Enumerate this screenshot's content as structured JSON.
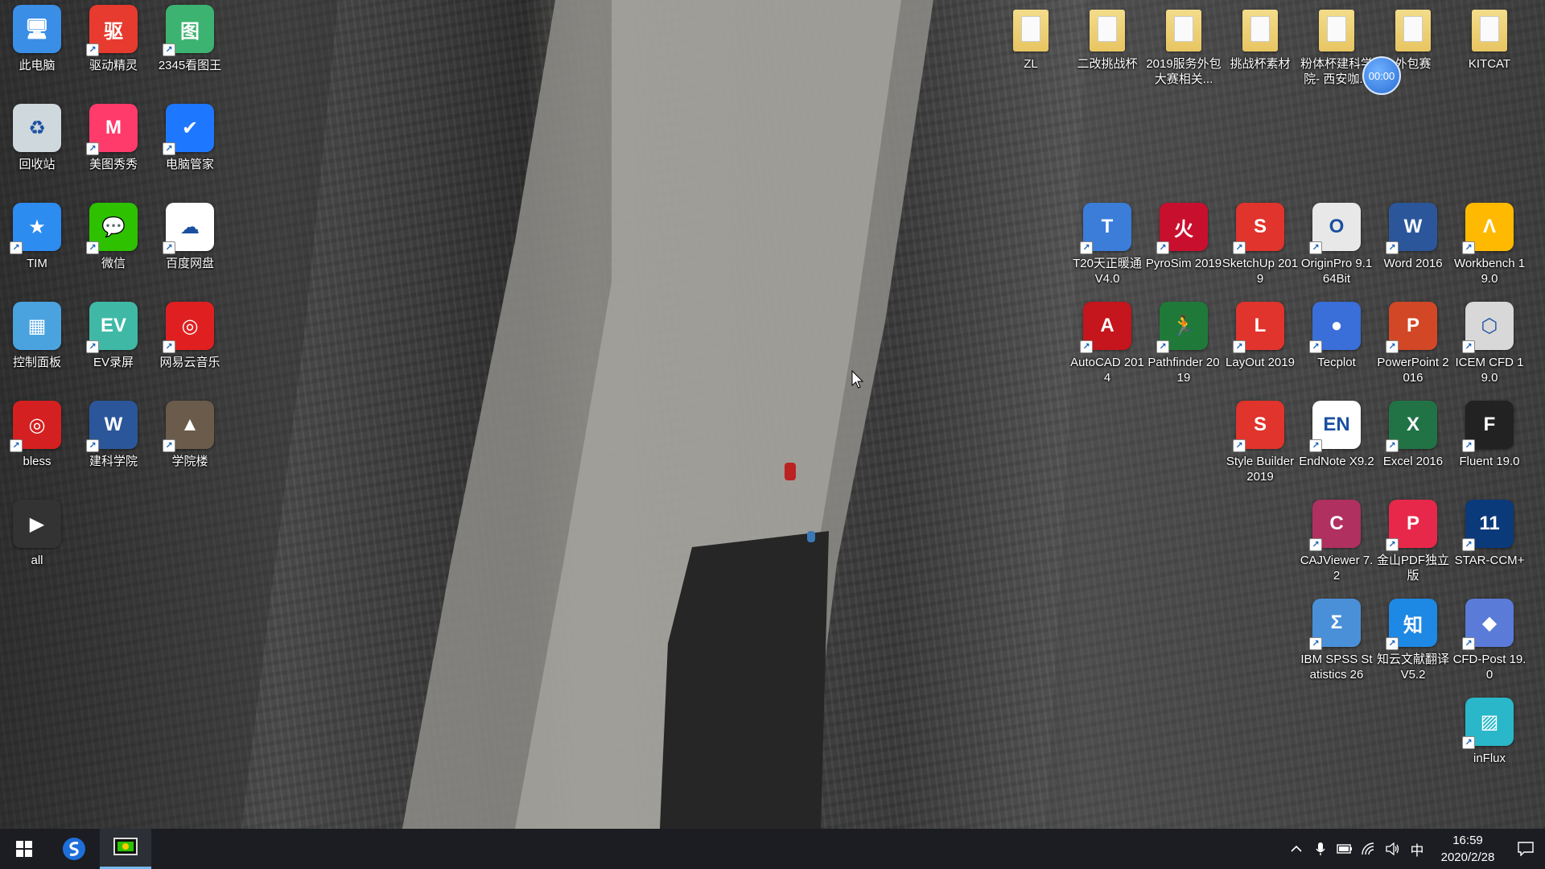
{
  "desktop": {
    "icons": [
      {
        "id": "this-pc",
        "label": "此电脑",
        "glyph": "🖥",
        "color": "#3a8ee6",
        "icon": "computer-icon"
      },
      {
        "id": "driver-genius",
        "label": "驱动精灵",
        "glyph": "驱",
        "color": "#e63b2e",
        "icon": "driver-genius-icon"
      },
      {
        "id": "2345-viewer",
        "label": "2345看图王",
        "glyph": "图",
        "color": "#3cb371",
        "icon": "image-viewer-icon"
      },
      {
        "id": "recycle-bin",
        "label": "回收站",
        "glyph": "♻",
        "color": "#cfd8dc",
        "icon": "recycle-bin-icon"
      },
      {
        "id": "meitu",
        "label": "美图秀秀",
        "glyph": "M",
        "color": "#ff3b6b",
        "icon": "meitu-icon"
      },
      {
        "id": "pc-manager",
        "label": "电脑管家",
        "glyph": "✔",
        "color": "#1e78ff",
        "icon": "pc-manager-icon"
      },
      {
        "id": "tim",
        "label": "TIM",
        "glyph": "★",
        "color": "#2d8cf0",
        "icon": "tim-icon"
      },
      {
        "id": "wechat",
        "label": "微信",
        "glyph": "💬",
        "color": "#2dc100",
        "icon": "wechat-icon"
      },
      {
        "id": "baidu-pan",
        "label": "百度网盘",
        "glyph": "☁",
        "color": "#ffffff",
        "icon": "baidu-pan-icon"
      },
      {
        "id": "control-panel",
        "label": "控制面板",
        "glyph": "▦",
        "color": "#4aa3df",
        "icon": "control-panel-icon"
      },
      {
        "id": "ev-recorder",
        "label": "EV录屏",
        "glyph": "EV",
        "color": "#3fb9a6",
        "icon": "ev-recorder-icon"
      },
      {
        "id": "netease-music",
        "label": "网易云音乐",
        "glyph": "◎",
        "color": "#e02020",
        "icon": "netease-music-icon"
      },
      {
        "id": "bless",
        "label": "bless",
        "glyph": "◎",
        "color": "#d42020",
        "icon": "bless-icon"
      },
      {
        "id": "jianke",
        "label": "建科学院",
        "glyph": "W",
        "color": "#2b579a",
        "icon": "word-document-icon"
      },
      {
        "id": "xueyuanlou",
        "label": "学院楼",
        "glyph": "▲",
        "color": "#6b5b4b",
        "icon": "image-file-icon"
      },
      {
        "id": "all",
        "label": "all",
        "glyph": "▶",
        "color": "#333333",
        "icon": "video-file-icon"
      },
      {
        "id": "zl",
        "label": "ZL",
        "glyph": "",
        "color": "folder",
        "icon": "folder-icon"
      },
      {
        "id": "erjiao",
        "label": "二改挑战杯",
        "glyph": "",
        "color": "folder",
        "icon": "folder-icon"
      },
      {
        "id": "service-2019",
        "label": "2019服务外包大赛相关...",
        "glyph": "",
        "color": "folder",
        "icon": "folder-icon"
      },
      {
        "id": "challenge-material",
        "label": "挑战杯素材",
        "glyph": "",
        "color": "folder",
        "icon": "folder-icon"
      },
      {
        "id": "powder-cup",
        "label": "粉体杯建科学院- 西安咖...",
        "glyph": "",
        "color": "folder",
        "icon": "folder-icon"
      },
      {
        "id": "outsource",
        "label": "外包赛",
        "glyph": "",
        "color": "folder",
        "icon": "folder-icon"
      },
      {
        "id": "kitcat",
        "label": "KITCAT",
        "glyph": "",
        "color": "folder",
        "icon": "folder-icon"
      },
      {
        "id": "t20",
        "label": "T20天正暖通 V4.0",
        "glyph": "T",
        "color": "#3b7dd8",
        "icon": "t20-icon"
      },
      {
        "id": "pyrosim",
        "label": "PyroSim 2019",
        "glyph": "火",
        "color": "#c8102e",
        "icon": "pyrosim-icon"
      },
      {
        "id": "sketchup",
        "label": "SketchUp 2019",
        "glyph": "S",
        "color": "#e0342c",
        "icon": "sketchup-icon"
      },
      {
        "id": "originpro",
        "label": "OriginPro 9.1 64Bit",
        "glyph": "O",
        "color": "#e8e8e8",
        "icon": "originpro-icon"
      },
      {
        "id": "word",
        "label": "Word 2016",
        "glyph": "W",
        "color": "#2b579a",
        "icon": "word-icon"
      },
      {
        "id": "workbench",
        "label": "Workbench 19.0",
        "glyph": "Λ",
        "color": "#ffb900",
        "icon": "workbench-icon"
      },
      {
        "id": "autocad",
        "label": "AutoCAD 2014",
        "glyph": "A",
        "color": "#c4161c",
        "icon": "autocad-icon"
      },
      {
        "id": "pathfinder",
        "label": "Pathfinder 2019",
        "glyph": "🏃",
        "color": "#1f7a3a",
        "icon": "pathfinder-icon"
      },
      {
        "id": "layout",
        "label": "LayOut 2019",
        "glyph": "L",
        "color": "#e0342c",
        "icon": "layout-icon"
      },
      {
        "id": "tecplot",
        "label": "Tecplot",
        "glyph": "●",
        "color": "#3a6ed8",
        "icon": "tecplot-icon"
      },
      {
        "id": "powerpoint",
        "label": "PowerPoint 2016",
        "glyph": "P",
        "color": "#d24726",
        "icon": "powerpoint-icon"
      },
      {
        "id": "icem",
        "label": "ICEM CFD 19.0",
        "glyph": "⬡",
        "color": "#d8d8d8",
        "icon": "icem-icon"
      },
      {
        "id": "stylebuilder",
        "label": "Style Builder 2019",
        "glyph": "S",
        "color": "#e0342c",
        "icon": "style-builder-icon"
      },
      {
        "id": "endnote",
        "label": "EndNote X9.2",
        "glyph": "EN",
        "color": "#ffffff",
        "icon": "endnote-icon"
      },
      {
        "id": "excel",
        "label": "Excel 2016",
        "glyph": "X",
        "color": "#217346",
        "icon": "excel-icon"
      },
      {
        "id": "fluent",
        "label": "Fluent 19.0",
        "glyph": "F",
        "color": "#222222",
        "icon": "fluent-icon"
      },
      {
        "id": "cajviewer",
        "label": "CAJViewer 7.2",
        "glyph": "C",
        "color": "#b03060",
        "icon": "cajviewer-icon"
      },
      {
        "id": "wps-pdf",
        "label": "金山PDF独立版",
        "glyph": "P",
        "color": "#e8284a",
        "icon": "pdf-icon"
      },
      {
        "id": "starccm",
        "label": "STAR-CCM+",
        "glyph": "11",
        "color": "#0a3a7a",
        "icon": "starccm-icon"
      },
      {
        "id": "spss",
        "label": "IBM SPSS Statistics 26",
        "glyph": "Σ",
        "color": "#4a90d9",
        "icon": "spss-icon"
      },
      {
        "id": "zhiyun",
        "label": "知云文献翻译 V5.2",
        "glyph": "知",
        "color": "#1e88e5",
        "icon": "translate-icon"
      },
      {
        "id": "cfdpost",
        "label": "CFD-Post 19.0",
        "glyph": "◆",
        "color": "#5a7bd8",
        "icon": "cfd-post-icon"
      },
      {
        "id": "influx",
        "label": "inFlux",
        "glyph": "▨",
        "color": "#2ab7c9",
        "icon": "influx-icon"
      }
    ],
    "recorder_timer": "00:00"
  },
  "taskbar": {
    "start_icon": "windows-start-icon",
    "pinned": [
      {
        "id": "sogou",
        "icon": "sogou-icon",
        "color": "#1e6fd9"
      },
      {
        "id": "ev-running",
        "icon": "screen-recorder-icon",
        "color": "#2dc100",
        "active": true
      }
    ],
    "tray": {
      "input_method": "中",
      "time": "16:59",
      "date": "2020/2/28"
    }
  },
  "colors": {
    "taskbar_bg": "#1b1d22",
    "active_indicator": "#76b9ed"
  }
}
